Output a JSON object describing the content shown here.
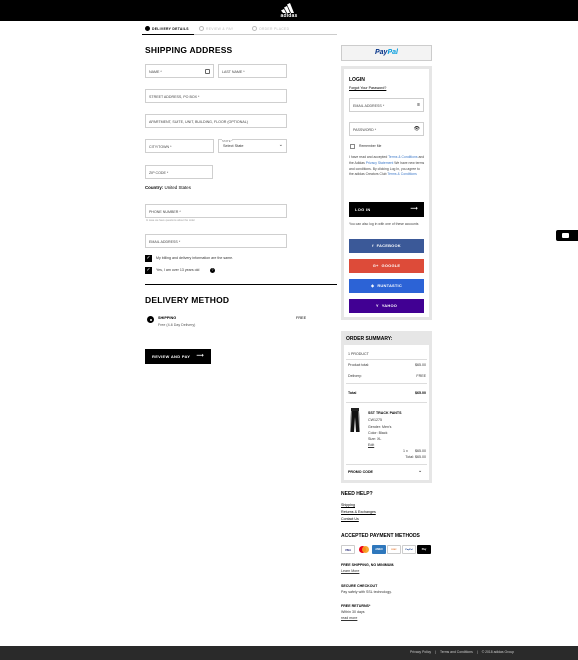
{
  "header": {
    "logo_text": "adidas"
  },
  "steps": [
    {
      "label": "DELIVERY DETAILS"
    },
    {
      "label": "REVIEW & PAY"
    },
    {
      "label": "ORDER PLACED"
    }
  ],
  "shipping": {
    "title": "SHIPPING ADDRESS",
    "first_name": "NAME *",
    "last_name": "LAST NAME *",
    "street": "STREET ADDRESS, PO BOX *",
    "apartment": "APARTMENT, SUITE, UNIT, BUILDING, FLOOR (OPTIONAL)",
    "city": "CITY/TOWN *",
    "state_label": "STATE *",
    "state_value": "Select State",
    "zip": "ZIP CODE *",
    "country_label": "Country:",
    "country_value": "United States",
    "phone": "PHONE NUMBER *",
    "phone_helper": "In case we have questions about the order",
    "email": "EMAIL ADDRESS *",
    "check_billing": "My billing and delivery information are the same.",
    "check_age": "Yes, I am over 13 years old"
  },
  "delivery": {
    "title": "DELIVERY METHOD",
    "option_title": "SHIPPING",
    "option_sub": "Free (4-6 Day Delivery)",
    "option_price": "FREE"
  },
  "review_button": "REVIEW AND PAY",
  "paypal": {
    "p1": "Pay",
    "p2": "Pal"
  },
  "login": {
    "title": "LOGIN",
    "forgot": "Forgot Your Password?",
    "email": "EMAIL ADDRESS *",
    "password": "PASSWORD *",
    "remember": "Remember Me",
    "legal_1": "I have read and accepted ",
    "legal_terms": "Terms & Conditions",
    "legal_2": " and the Adidas ",
    "legal_privacy": "Privacy Statement",
    "legal_3": " We have new terms and conditions. By clicking Log In, you agree to the adidas Creators Club ",
    "legal_terms2": "Terms & Conditions",
    "button": "LOG IN",
    "social_intro": "You can also log in with one of these accounts",
    "facebook": "FACEBOOK",
    "google": "GOOGLE",
    "runtastic": "RUNTASTIC",
    "yahoo": "YAHOO"
  },
  "summary": {
    "title": "ORDER SUMMARY:",
    "count": "1 PRODUCT",
    "product_total_label": "Product total:",
    "product_total": "$65.00",
    "delivery_label": "Delivery:",
    "delivery": "FREE",
    "total_label": "Total",
    "total": "$65.00",
    "item_name": "SST TRACK PANTS",
    "item_code": "CW1275",
    "item_gender": "Gender: Men's",
    "item_color": "Color: Black",
    "item_size": "Size: XL",
    "item_edit": "Edit",
    "item_qty": "1 x",
    "item_price": "$65.00",
    "item_total": "Total: $65.00",
    "promo": "PROMO CODE"
  },
  "help": {
    "title": "NEED HELP?",
    "links": [
      "Shipping",
      "Returns & Exchanges",
      "Contact Us"
    ]
  },
  "payments": {
    "title": "ACCEPTED PAYMENT METHODS",
    "icons": [
      "VISA",
      "MC",
      "AMEX",
      "DISC",
      "PayPal",
      "Pay"
    ]
  },
  "info": [
    {
      "title": "FREE SHIPPING, NO MINIMUM.",
      "text": "Learn More"
    },
    {
      "title": "SECURE CHECKOUT",
      "text": "Pay safely with SSL technology."
    },
    {
      "title": "FREE RETURNS*",
      "text": "Within 30 days",
      "text2": "read more"
    }
  ],
  "footer": {
    "privacy": "Privacy Policy",
    "terms": "Terms and Conditions",
    "copyright": "© 2018 adidas Group"
  },
  "colors": {
    "facebook": "#3b5998",
    "google": "#dd4b39",
    "runtastic": "#2c63d6",
    "yahoo": "#410093"
  }
}
